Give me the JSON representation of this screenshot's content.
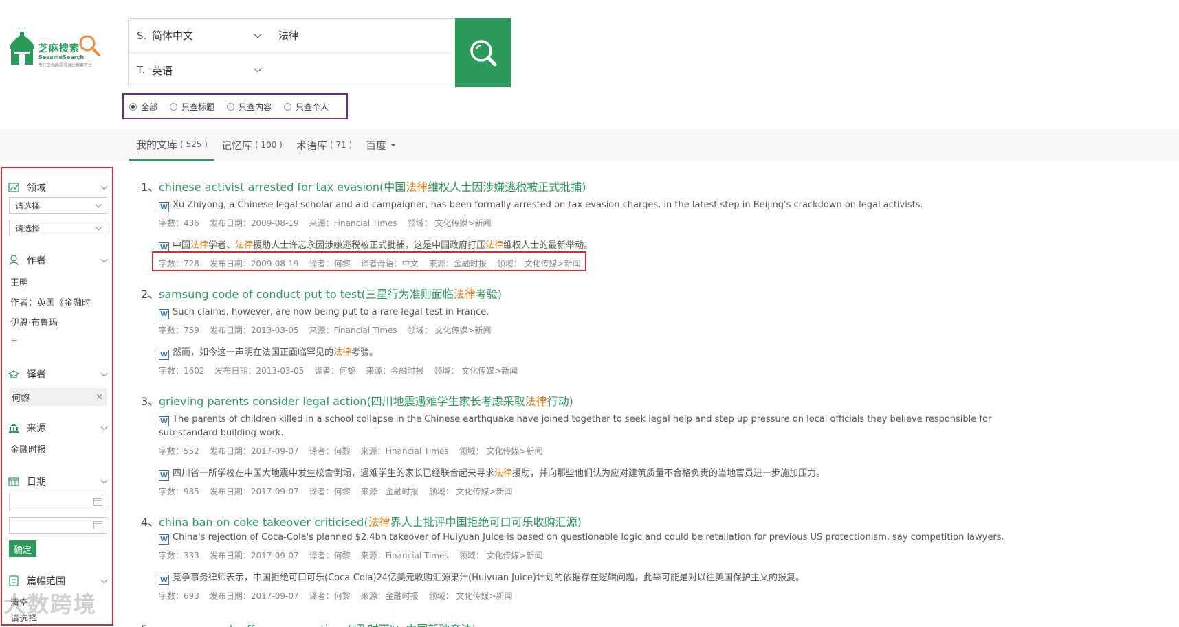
{
  "logo": {
    "brand": "芝麻搜索",
    "brand_en": "SesameSearch",
    "tagline": "专注文档的语言对比搜索平台"
  },
  "search": {
    "source_prefix": "S.",
    "source_lang": "简体中文",
    "target_prefix": "T.",
    "target_lang": "英语",
    "query": "法律"
  },
  "scope": [
    "全部",
    "只查标题",
    "只查内容",
    "只查个人"
  ],
  "tabs": [
    {
      "label": "我的文库",
      "count": "( 525 )"
    },
    {
      "label": "记忆库",
      "count": "( 100 )"
    },
    {
      "label": "术语库",
      "count": "( 71 )"
    },
    {
      "label": "百度",
      "count": ""
    }
  ],
  "sidebar": {
    "domain": "领域",
    "select_placeholder": "请选择",
    "author": "作者",
    "authors": [
      "王明",
      "作者：英国《金融时",
      "伊恩·布鲁玛",
      "+"
    ],
    "translator": "译者",
    "translator_selected": "何黎",
    "source": "来源",
    "source_value": "金融时报",
    "date": "日期",
    "confirm": "确定",
    "length": "篇幅范围",
    "length_clear": "清空",
    "watermark": "大数跨境"
  },
  "results": [
    {
      "num": "1、",
      "title": [
        "chinese activist arrested for tax evasion(中国",
        "法律",
        "维权人士因涉嫌逃税被正式批捕)"
      ],
      "en": "Xu Zhiyong, a Chinese legal scholar and aid campaigner, has been formally arrested on tax evasion charges, in the latest step in Beijing's crackdown on legal activists.",
      "en_meta": [
        "字数：436",
        "发布日期：2009-08-19",
        "来源：Financial Times",
        "领域： 文化传媒>新闻"
      ],
      "zh": [
        "中国",
        "法律",
        "学者、",
        "法律",
        "援助人士许志永因涉嫌逃税被正式批捕，这是中国政府打压",
        "法律",
        "维权人士的最新举动。"
      ],
      "zh_meta": [
        "字数：728",
        "发布日期：2009-08-19",
        "译者：何黎",
        "译者母语：中文",
        "来源：金融时报",
        "领域： 文化传媒>新闻"
      ]
    },
    {
      "num": "2、",
      "title": [
        "samsung code of conduct put to test(三星行为准则面临",
        "法律",
        "考验)"
      ],
      "en": "Such claims, however, are now being put to a rare legal test in France.",
      "en_meta": [
        "字数：759",
        "发布日期：2013-03-05",
        "来源：Financial Times",
        "领域： 文化传媒>新闻"
      ],
      "zh": [
        "然而，如今这一声明在法国正面临罕见的",
        "法律",
        "考验。"
      ],
      "zh_meta": [
        "字数：1602",
        "发布日期：2013-03-05",
        "译者：何黎",
        "来源：金融时报",
        "领域： 文化传媒>新闻"
      ]
    },
    {
      "num": "3、",
      "title": [
        "grieving parents consider legal action(四川地震遇难学生家长考虑采取",
        "法律",
        "行动)"
      ],
      "en": "The parents of children killed in a school collapse in the Chinese earthquake have joined together to seek legal help and step up pressure on local officials they believe responsible for sub-standard building work.",
      "en_meta": [
        "字数：552",
        "发布日期：2017-09-07",
        "译者：何黎",
        "来源：Financial Times",
        "领域： 文化传媒>新闻"
      ],
      "zh": [
        "四川省一所学校在中国大地震中发生校舍倒塌，遇难学生的家长已经联合起来寻求",
        "法律",
        "援助，并向那些他们认为应对建筑质量不合格负责的当地官员进一步施加压力。"
      ],
      "zh_meta": [
        "字数：985",
        "发布日期：2017-09-07",
        "译者：何黎",
        "来源：金融时报",
        "领域： 文化传媒>新闻"
      ]
    },
    {
      "num": "4、",
      "title": [
        "china ban on coke takeover criticised(",
        "法律",
        "界人士批评中国拒绝可口可乐收购汇源)"
      ],
      "en": "China's rejection of Coca-Cola's planned $2.4bn takeover of Huiyuan Juice is based on questionable logic and could be retaliation for previous US protectionism, say competition lawyers.",
      "en_meta": [
        "字数：333",
        "发布日期：2017-09-07",
        "译者：何黎",
        "来源：Financial Times",
        "领域： 文化传媒>新闻"
      ],
      "zh": [
        "竞争事务律师表示，中国拒绝可口可乐(Coca-Cola)24亿美元收购汇源果汁(Huiyuan Juice)计划的依据存在逻辑问题，此举可能是对以往美国保护主义的报复。"
      ],
      "zh_meta": [
        "字数：693",
        "发布日期：2017-09-07",
        "译者：何黎",
        "来源：金融时报",
        "领域： 文化传媒>新闻"
      ]
    },
    {
      "num": "5、",
      "title": [
        "new approach offers more options(\"及时雨\"：中国新破产法)"
      ]
    }
  ],
  "colors": {
    "brand_green": "#2b9a5b",
    "highlight": "#e87e1a",
    "alert_red": "#d32f2f",
    "scope_purple": "#6a2c91"
  }
}
